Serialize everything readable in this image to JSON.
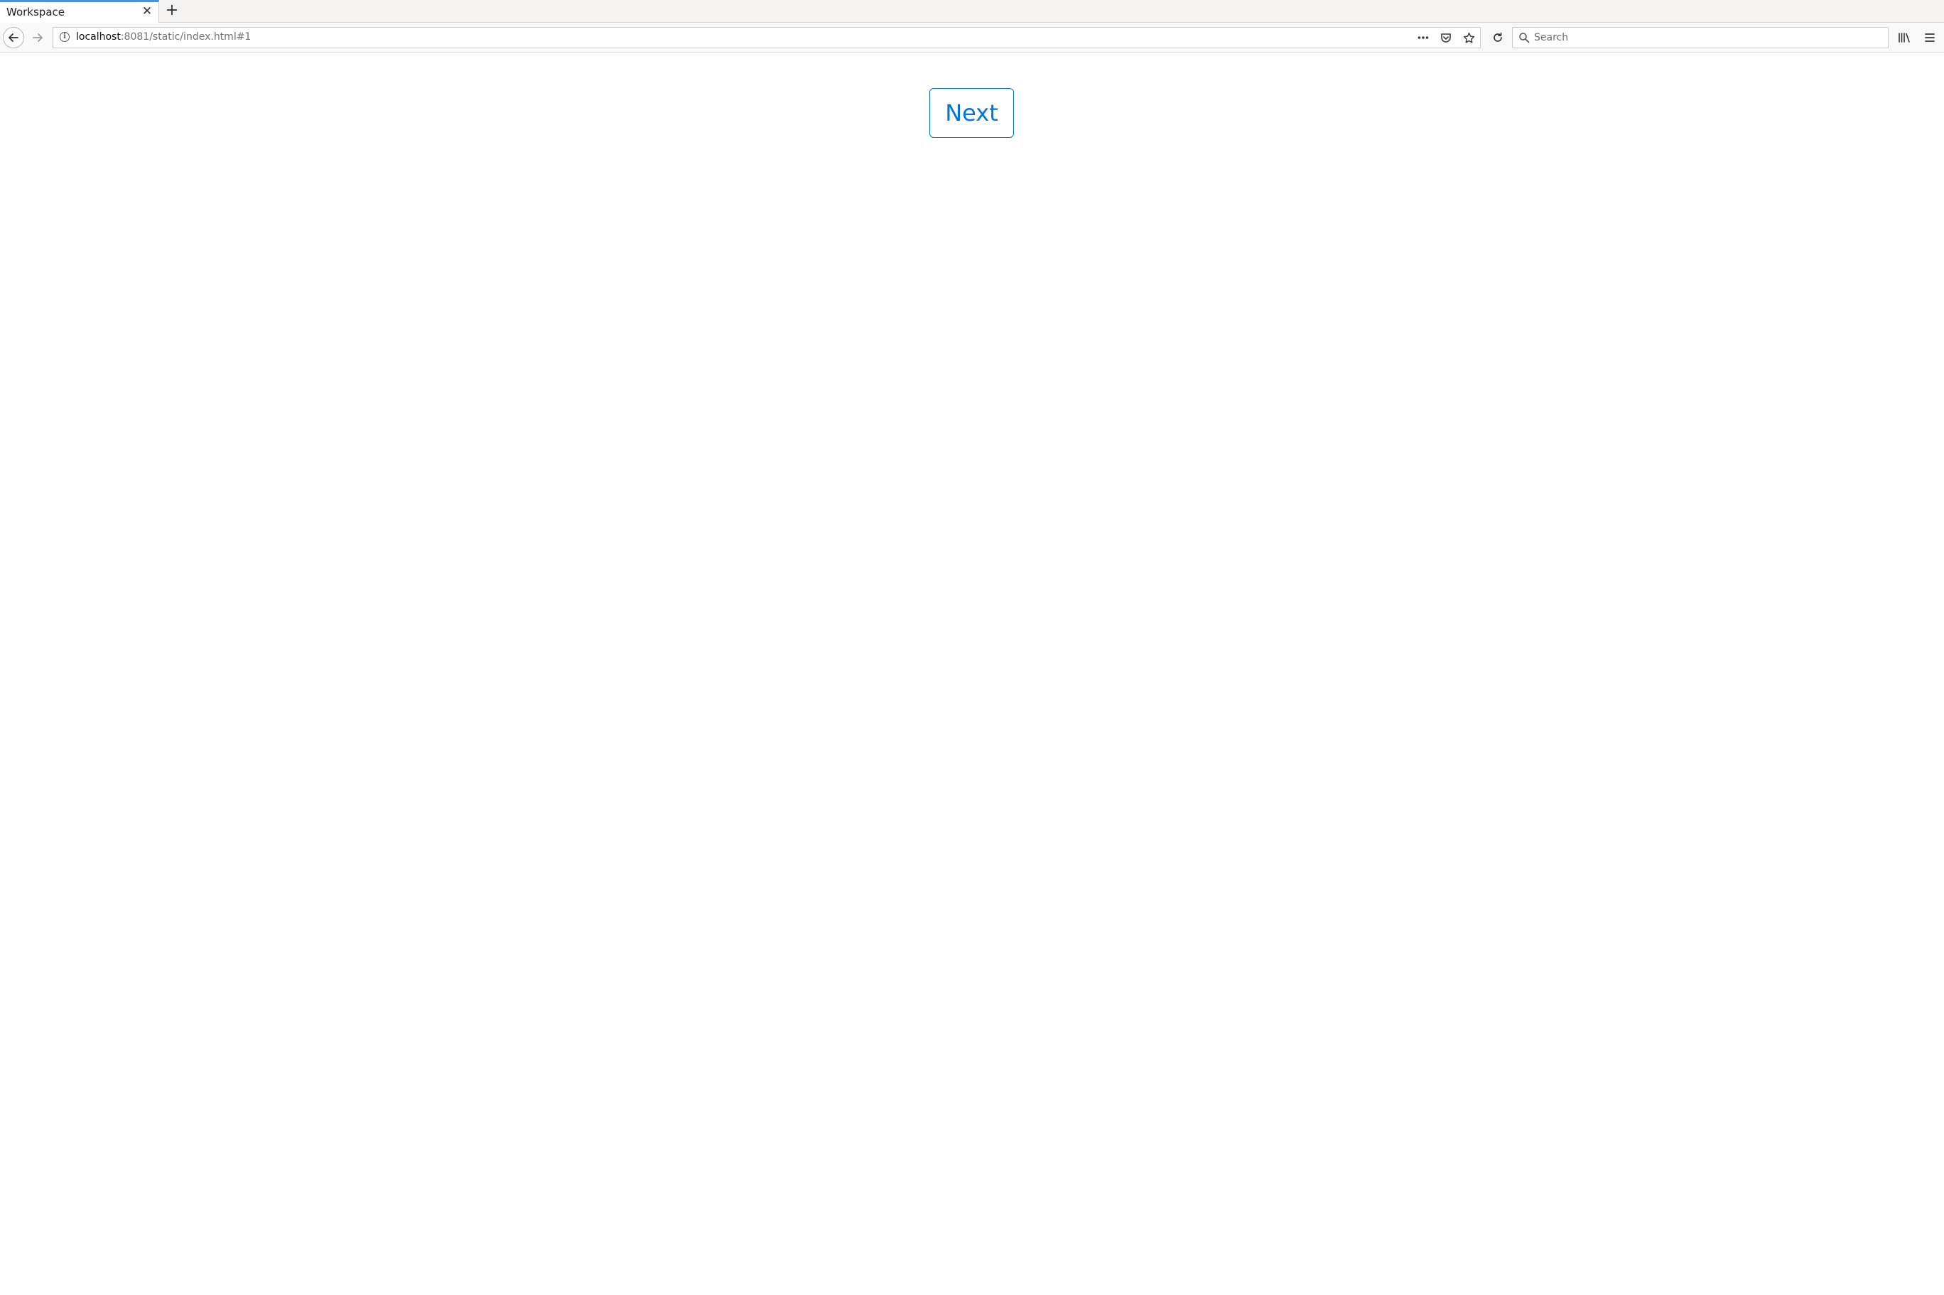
{
  "tabs": [
    {
      "title": "Workspace",
      "close_glyph": "✕"
    }
  ],
  "new_tab_glyph": "+",
  "navbar": {
    "url_host": "localhost",
    "url_rest": ":8081/static/index.html#1",
    "search_placeholder": "Search"
  },
  "icons": {
    "back": "back-arrow-icon",
    "forward": "forward-arrow-icon",
    "info": "info-icon",
    "more": "more-dots-icon",
    "pocket": "pocket-icon",
    "bookmark": "bookmark-star-icon",
    "reload": "reload-icon",
    "search": "search-icon",
    "library": "library-icon",
    "menu": "hamburger-menu-icon"
  },
  "colors": {
    "accent": "#0074d9",
    "tab_highlight": "#4a90d9"
  },
  "main": {
    "next_label": "Next"
  }
}
